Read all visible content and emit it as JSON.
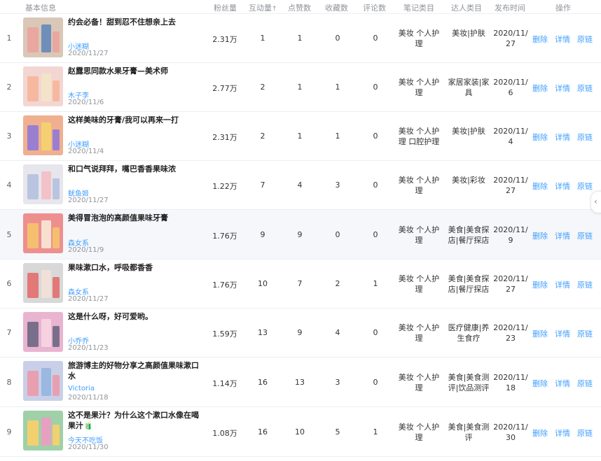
{
  "header": {
    "basic_info": "基本信息",
    "fans": "粉丝量",
    "interactions": "互动量",
    "likes": "点赞数",
    "collects": "收藏数",
    "comments": "评论数",
    "note_category": "笔记类目",
    "influencer_category": "达人类目",
    "publish_time": "发布时间",
    "actions": "操作",
    "sort_icon": "sort-arrow-icon"
  },
  "actions": {
    "delete": "删除",
    "detail": "详情",
    "link": "原链"
  },
  "rows": [
    {
      "index": "1",
      "title": "约会必备！甜到忍不住想亲上去",
      "author": "小迷糊",
      "date": "2020/11/27",
      "fans": "2.31万",
      "interactions": "1",
      "likes": "1",
      "collects": "0",
      "comments": "0",
      "note_cat": [
        "美妆 个人护",
        "理"
      ],
      "inf_cat": [
        "美妆|护肤"
      ],
      "time": [
        "2020/11/",
        "27"
      ]
    },
    {
      "index": "2",
      "title": "赵露思同款水果牙膏—美术师",
      "author": "木子李",
      "date": "2020/11/6",
      "fans": "2.77万",
      "interactions": "2",
      "likes": "1",
      "collects": "1",
      "comments": "0",
      "note_cat": [
        "美妆 个人护",
        "理"
      ],
      "inf_cat": [
        "家居家装|家",
        "具"
      ],
      "time": [
        "2020/11/",
        "6"
      ]
    },
    {
      "index": "3",
      "title": "这样美味的牙膏/我可以再来一打",
      "author": "小迷糊",
      "date": "2020/11/4",
      "fans": "2.31万",
      "interactions": "2",
      "likes": "1",
      "collects": "1",
      "comments": "0",
      "note_cat": [
        "美妆 个人护",
        "理 口腔护理"
      ],
      "inf_cat": [
        "美妆|护肤"
      ],
      "time": [
        "2020/11/",
        "4"
      ]
    },
    {
      "index": "4",
      "title": "和口气说拜拜，嘴巴香香果味浓",
      "author": "鱿鱼姬",
      "date": "2020/11/27",
      "fans": "1.22万",
      "interactions": "7",
      "likes": "4",
      "collects": "3",
      "comments": "0",
      "note_cat": [
        "美妆 个人护",
        "理"
      ],
      "inf_cat": [
        "美妆|彩妆"
      ],
      "time": [
        "2020/11/",
        "27"
      ]
    },
    {
      "index": "5",
      "title": "美得冒泡泡的高颜值果味牙膏",
      "author": "森女系",
      "date": "2020/11/9",
      "fans": "1.76万",
      "interactions": "9",
      "likes": "9",
      "collects": "0",
      "comments": "0",
      "note_cat": [
        "美妆 个人护",
        "理"
      ],
      "inf_cat": [
        "美食|美食探",
        "店|餐厅探店"
      ],
      "time": [
        "2020/11/",
        "9"
      ]
    },
    {
      "index": "6",
      "title": "果味漱口水，呼吸都香香",
      "author": "森女系",
      "date": "2020/11/27",
      "fans": "1.76万",
      "interactions": "10",
      "likes": "7",
      "collects": "2",
      "comments": "1",
      "note_cat": [
        "美妆 个人护",
        "理"
      ],
      "inf_cat": [
        "美食|美食探",
        "店|餐厅探店"
      ],
      "time": [
        "2020/11/",
        "27"
      ]
    },
    {
      "index": "7",
      "title": "这是什么呀，好可爱哟。",
      "author": "小乔乔",
      "date": "2020/11/23",
      "fans": "1.59万",
      "interactions": "13",
      "likes": "9",
      "collects": "4",
      "comments": "0",
      "note_cat": [
        "美妆 个人护",
        "理"
      ],
      "inf_cat": [
        "医疗健康|养",
        "生食疗"
      ],
      "time": [
        "2020/11/",
        "23"
      ]
    },
    {
      "index": "8",
      "title": "旅游博主的好物分享之高颜值果味漱口水",
      "author": "Victoria",
      "date": "2020/11/18",
      "fans": "1.14万",
      "interactions": "16",
      "likes": "13",
      "collects": "3",
      "comments": "0",
      "note_cat": [
        "美妆 个人护",
        "理"
      ],
      "inf_cat": [
        "美食|美食测",
        "评|饮品测评"
      ],
      "time": [
        "2020/11/",
        "18"
      ]
    },
    {
      "index": "9",
      "title": "这不是果汁？为什么这个漱口水像在喝果汁🧃",
      "author": "今天不吃饭",
      "date": "2020/11/30",
      "fans": "1.08万",
      "interactions": "16",
      "likes": "10",
      "collects": "5",
      "comments": "1",
      "note_cat": [
        "美妆 个人护",
        "理"
      ],
      "inf_cat": [
        "美食|美食测",
        "评"
      ],
      "time": [
        "2020/11/",
        "30"
      ]
    }
  ],
  "thumb_colors": [
    [
      "#d9c7b8",
      "#e9a7a0",
      "#6f8fb8"
    ],
    [
      "#f3d6d2",
      "#f6b9a0",
      "#f2e3c9"
    ],
    [
      "#f0b090",
      "#9a7fd0",
      "#f4d070"
    ],
    [
      "#e6e6ec",
      "#b9c4e0",
      "#f3c2c8"
    ],
    [
      "#ee8f8f",
      "#f4c070",
      "#f7e0d0"
    ],
    [
      "#d8d8d8",
      "#e27878",
      "#f1e0d8"
    ],
    [
      "#e8b4d0",
      "#7a6f8a",
      "#f6d2e0"
    ],
    [
      "#c9cfe8",
      "#e8a0b0",
      "#9ab8e0"
    ],
    [
      "#9fd0a8",
      "#f2d070",
      "#e8a0c0"
    ]
  ],
  "side_handle_icon": "chevron-left-icon"
}
